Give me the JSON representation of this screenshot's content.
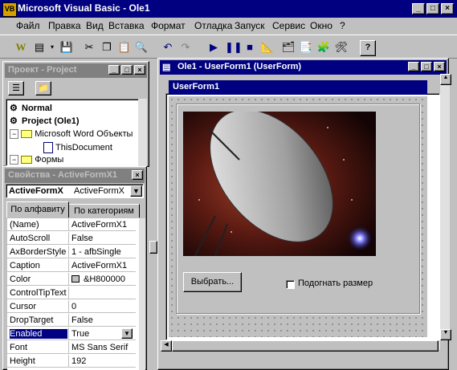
{
  "window": {
    "title": "Microsoft Visual Basic - Ole1"
  },
  "menu": [
    "Файл",
    "Правка",
    "Вид",
    "Вставка",
    "Формат",
    "Отладка",
    "Запуск",
    "Сервис",
    "Окно",
    "?"
  ],
  "project": {
    "title": "Проект - Project",
    "tree": [
      "Normal",
      "Project (Ole1)",
      "Microsoft Word Объекты",
      "ThisDocument",
      "Формы"
    ]
  },
  "properties": {
    "title": "Свойства - ActiveFormX1",
    "object_name": "ActiveFormX",
    "object_type": "ActiveFormX",
    "tab_alpha": "По алфавиту",
    "tab_cat": "По категориям",
    "rows": [
      {
        "name": "(Name)",
        "value": "ActiveFormX1"
      },
      {
        "name": "AutoScroll",
        "value": "False"
      },
      {
        "name": "AxBorderStyle",
        "value": "1 - afbSingle"
      },
      {
        "name": "Caption",
        "value": "ActiveFormX1"
      },
      {
        "name": "Color",
        "value": "&H800000"
      },
      {
        "name": "ControlTipText",
        "value": ""
      },
      {
        "name": "Cursor",
        "value": "0"
      },
      {
        "name": "DropTarget",
        "value": "False"
      },
      {
        "name": "Enabled",
        "value": "True"
      },
      {
        "name": "Font",
        "value": "MS Sans Serif"
      },
      {
        "name": "Height",
        "value": "192"
      }
    ],
    "selected_index": 8
  },
  "userform_window": {
    "title": "Ole1 - UserForm1 (UserForm)",
    "form_caption": "UserForm1",
    "select_button": "Выбрать...",
    "fit_checkbox": "Подогнать размер",
    "fit_checked": false
  },
  "colors": {
    "titlebar": "#000080",
    "face": "#c0c0c0",
    "selection": "#000080"
  }
}
